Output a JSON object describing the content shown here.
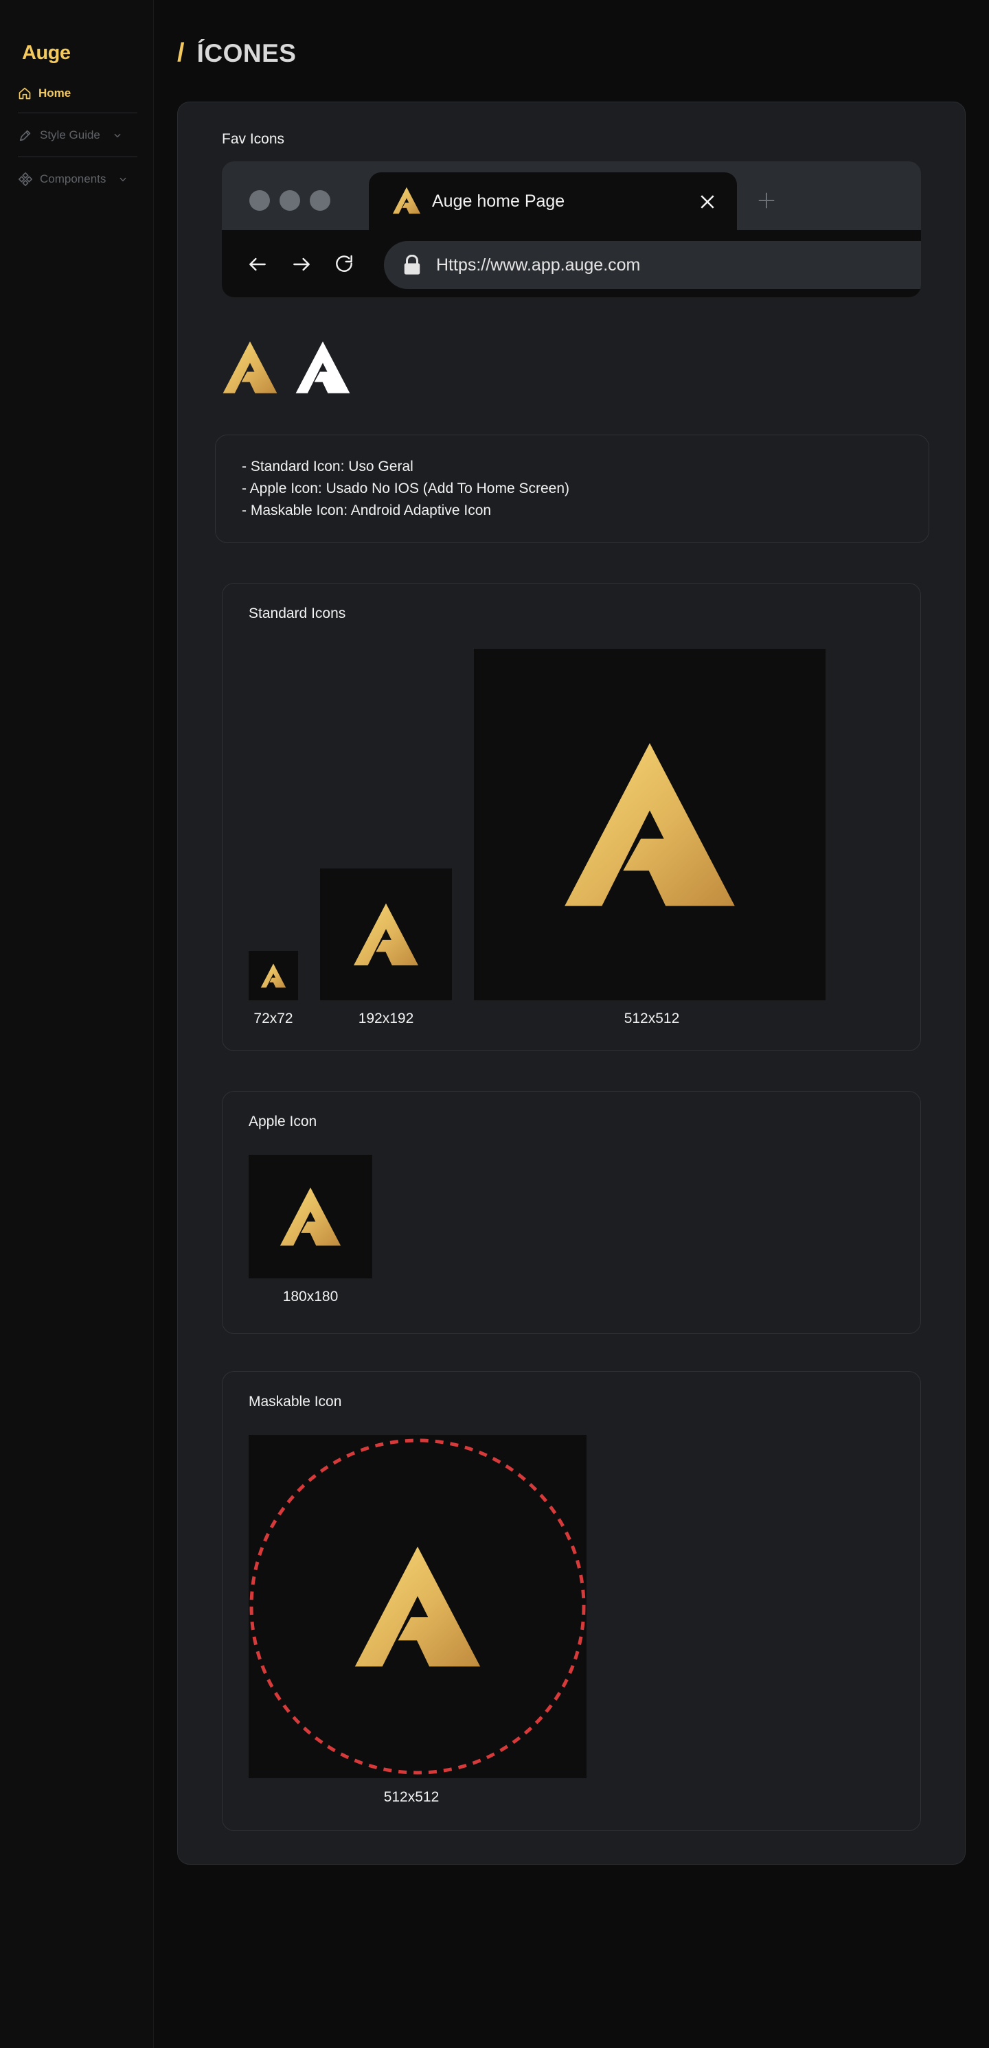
{
  "colors": {
    "accent": "#f4c95d",
    "background": "#0c0c0c",
    "card": "#1c1e21",
    "mask_circle": "#d63a3a"
  },
  "sidebar": {
    "logo": "Auge",
    "items": [
      {
        "label": "Home",
        "icon": "home-icon",
        "active": true
      },
      {
        "label": "Style Guide",
        "icon": "pen-icon",
        "expandable": true
      },
      {
        "label": "Components",
        "icon": "components-icon",
        "expandable": true
      }
    ]
  },
  "header": {
    "slash": "/",
    "title": "ÍCONES"
  },
  "fav_icons": {
    "title": "Fav Icons",
    "browser": {
      "tab_title": "Auge home Page",
      "url": "Https://www.app.auge.com"
    }
  },
  "info": {
    "lines": [
      "- Standard Icon: Uso Geral",
      "- Apple Icon: Usado No IOS (Add To Home Screen)",
      "- Maskable Icon: Android Adaptive Icon"
    ]
  },
  "standard_icons": {
    "title": "Standard Icons",
    "sizes": [
      "72x72",
      "192x192",
      "512x512"
    ]
  },
  "apple_icon": {
    "title": "Apple Icon",
    "size": "180x180"
  },
  "maskable_icon": {
    "title": "Maskable Icon",
    "size": "512x512"
  }
}
